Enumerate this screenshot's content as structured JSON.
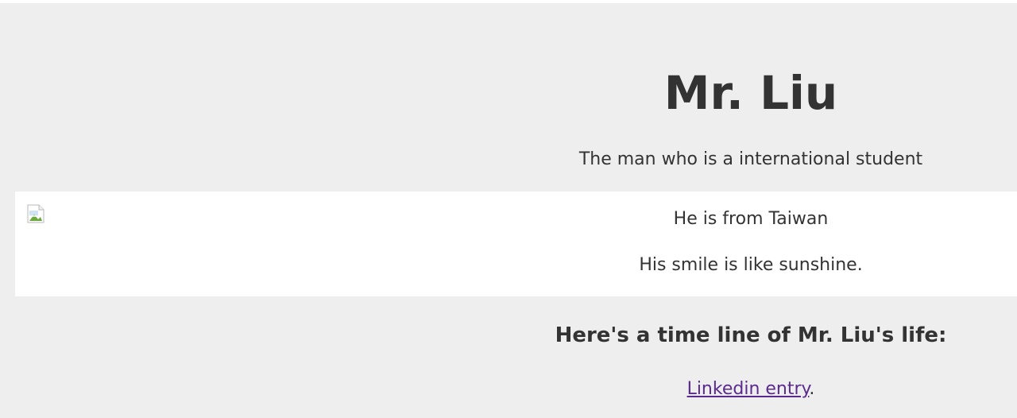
{
  "header": {
    "title": "Mr. Liu",
    "subtitle": "The man who is a international student"
  },
  "profile": {
    "image_icon": "broken-image-icon",
    "from": "He is from Taiwan",
    "smile": "His smile is like sunshine."
  },
  "timeline": {
    "heading": "Here's a time line of Mr. Liu's life:",
    "link_text": "Linkedin entry",
    "link_suffix": "."
  },
  "colors": {
    "page_background": "#eeeeee",
    "panel_background": "#ffffff",
    "text": "#333333",
    "link": "#5b2a8e"
  }
}
